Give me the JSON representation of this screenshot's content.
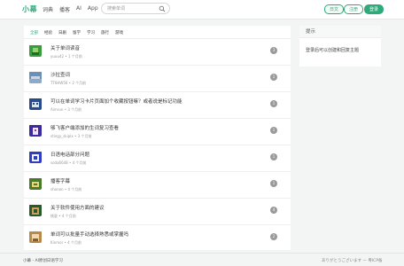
{
  "header": {
    "logo": "小幕",
    "nav": [
      "词典",
      "播客",
      "AI",
      "App"
    ],
    "search_placeholder": "搜索单词",
    "lang_button": "日文",
    "login_button": "注册",
    "register_button": "登录"
  },
  "tabs": [
    "全部",
    "经验",
    "日剧",
    "留学",
    "学习",
    "旅行",
    "游戏"
  ],
  "posts": [
    {
      "title": "关于单词读音",
      "meta": "yuuu42 • 1 个月前",
      "count": "3",
      "avatar_color": "#3a9b3f"
    },
    {
      "title": "沙拉查词",
      "meta": "TT6HW56 • 2 个月前",
      "count": "1",
      "avatar_color": "#6a8fb8"
    },
    {
      "title": "可以在单词学习卡片页面加个收藏按钮嘛？或者说是标记功能",
      "meta": "Aimrun • 3 个月前",
      "count": "1",
      "avatar_color": "#2a4a8a"
    },
    {
      "title": "够飞客户端添加的生词复习查看",
      "meta": "stingy_skiplx • 3 个月前",
      "count": "1",
      "avatar_color": "#3b2aa0"
    },
    {
      "title": "日语电话部分问题",
      "meta": "soda6648 • 4 个月前",
      "count": "1",
      "avatar_color": "#2f3fc0"
    },
    {
      "title": "播客字幕",
      "meta": "shonon • 4 个月前",
      "count": "1",
      "avatar_color": "#4a7a2a"
    },
    {
      "title": "关于软件使用方面的建议",
      "meta": "桃夏 • 4 个月前",
      "count": "4",
      "avatar_color": "#2a5a2a"
    },
    {
      "title": "单词可以批量手动选择熟悉或掌握吗",
      "meta": "Kinmor • 4 个月前",
      "count": "2",
      "avatar_color": "#b88a4a"
    }
  ],
  "sidebar": {
    "title": "提示",
    "text": "登录后可以创建和回复主题"
  },
  "footer": {
    "left": "小幕 - AI原创日语学习",
    "right": "ありがとうございます ー 粤ICP备"
  }
}
